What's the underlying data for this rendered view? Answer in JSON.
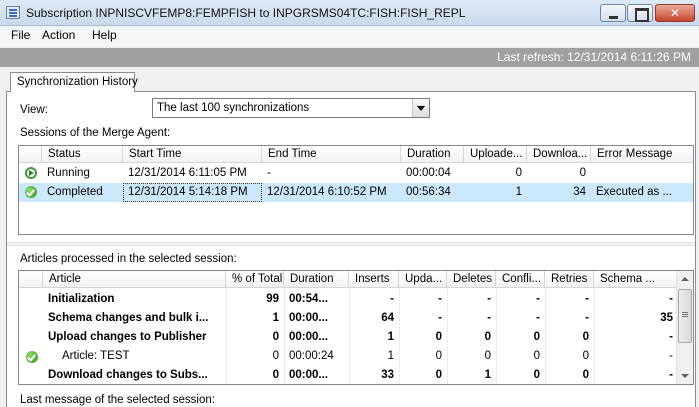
{
  "window": {
    "title": "Subscription INPNISCVFEMP8:FEMPFISH to INPGRSMS04TC:FISH:FISH_REPL"
  },
  "menu": [
    "File",
    "Action",
    "Help"
  ],
  "status": {
    "last_refresh": "Last refresh: 12/31/2014 6:11:26 PM"
  },
  "tab": {
    "label": "Synchronization History"
  },
  "view": {
    "label": "View:",
    "selected": "The last 100 synchronizations"
  },
  "sessions": {
    "label": "Sessions of the Merge Agent:",
    "columns": [
      "Status",
      "Start Time",
      "End Time",
      "Duration",
      "Uploade...",
      "Downloa...",
      "Error Message"
    ],
    "rows": [
      {
        "icon": "running-icon",
        "status": "Running",
        "start": "12/31/2014 6:11:05 PM",
        "end": "-",
        "duration": "00:00:04",
        "uploaded": "0",
        "downloaded": "0",
        "error": ""
      },
      {
        "icon": "success-icon",
        "status": "Completed",
        "start": "12/31/2014 5:14:18 PM",
        "end": "12/31/2014 6:10:52 PM",
        "duration": "00:56:34",
        "uploaded": "1",
        "downloaded": "34",
        "error": "Executed as ..."
      }
    ]
  },
  "articles": {
    "label": "Articles processed in the selected session:",
    "columns": [
      "Article",
      "% of Total",
      "Duration",
      "Inserts",
      "Upda...",
      "Deletes",
      "Confli...",
      "Retries",
      "Schema ..."
    ],
    "rows": [
      {
        "icon": "",
        "bold": true,
        "article": "Initialization",
        "pct": "99",
        "duration": "00:54...",
        "inserts": "-",
        "updates": "-",
        "deletes": "-",
        "conflicts": "-",
        "retries": "-",
        "schema": "-"
      },
      {
        "icon": "",
        "bold": true,
        "article": "Schema changes and bulk i...",
        "pct": "1",
        "duration": "00:00...",
        "inserts": "64",
        "updates": "-",
        "deletes": "-",
        "conflicts": "-",
        "retries": "-",
        "schema": "35"
      },
      {
        "icon": "",
        "bold": true,
        "article": "Upload changes to Publisher",
        "pct": "0",
        "duration": "00:00...",
        "inserts": "1",
        "updates": "0",
        "deletes": "0",
        "conflicts": "0",
        "retries": "0",
        "schema": "-"
      },
      {
        "icon": "success-icon",
        "bold": false,
        "article": "Article: TEST",
        "pct": "0",
        "duration": "00:00:24",
        "inserts": "1",
        "updates": "0",
        "deletes": "0",
        "conflicts": "0",
        "retries": "0",
        "schema": "-"
      },
      {
        "icon": "",
        "bold": true,
        "article": "Download changes to Subs...",
        "pct": "0",
        "duration": "00:00...",
        "inserts": "33",
        "updates": "0",
        "deletes": "1",
        "conflicts": "0",
        "retries": "0",
        "schema": "-"
      }
    ]
  },
  "last_message": {
    "label": "Last message of the selected session:"
  },
  "colors": {
    "selection": "#cce8ff",
    "refresh_bar": "#a0a0a0",
    "success": "#2f8f1d"
  }
}
